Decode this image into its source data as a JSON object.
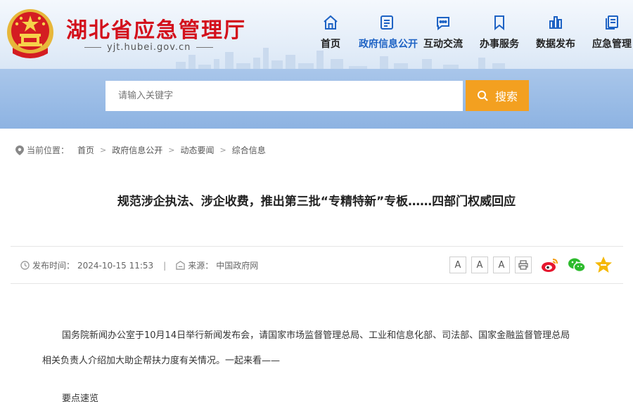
{
  "site": {
    "title": "湖北省应急管理厅",
    "url": "yjt.hubei.gov.cn"
  },
  "nav": [
    {
      "label": "首页",
      "icon": "home-icon"
    },
    {
      "label": "政府信息公开",
      "icon": "document-icon",
      "active": true
    },
    {
      "label": "互动交流",
      "icon": "chat-icon"
    },
    {
      "label": "办事服务",
      "icon": "bookmark-icon"
    },
    {
      "label": "数据发布",
      "icon": "bar-chart-icon"
    },
    {
      "label": "应急管理",
      "icon": "files-icon"
    }
  ],
  "search": {
    "placeholder": "请输入关键字",
    "button_label": "搜索"
  },
  "breadcrumb": {
    "prefix": "当前位置：",
    "items": [
      "首页",
      "政府信息公开",
      "动态要闻",
      "综合信息"
    ]
  },
  "article": {
    "title": "规范涉企执法、涉企收费，推出第三批“专精特新”专板……四部门权威回应",
    "publish_label": "发布时间：",
    "publish_time": "2024-10-15 11:53",
    "source_label": "来源：",
    "source": "中国政府网",
    "paragraph1": "国务院新闻办公室于10月14日举行新闻发布会，请国家市场监督管理总局、工业和信息化部、司法部、国家金融监督管理总局",
    "paragraph2": "相关负责人介绍加大助企帮扶力度有关情况。一起来看——",
    "subheading": "要点速览"
  },
  "font_buttons": [
    "A",
    "A",
    "A"
  ],
  "colors": {
    "title_red": "#d3101c",
    "nav_active": "#1d62c4",
    "search_orange": "#f3a020"
  }
}
